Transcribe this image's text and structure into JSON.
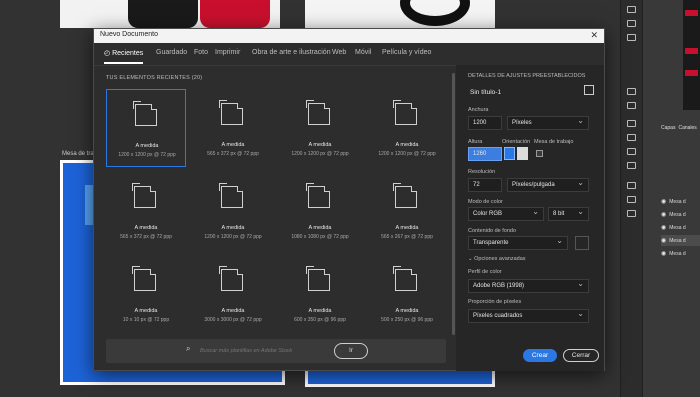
{
  "background": {
    "artboard_label": "Mesa de trab"
  },
  "panel": {
    "tabs": [
      "Capas",
      "Canales"
    ],
    "layer_names": [
      "Mesa d",
      "Mesa d",
      "Mesa d",
      "Mesa d",
      "Mesa d"
    ]
  },
  "dialog": {
    "title": "Nuevo Documento",
    "close": "✕",
    "tabs": [
      "Recientes",
      "Guardado",
      "Foto",
      "Imprimir",
      "Obra de arte e ilustración",
      "Web",
      "Móvil",
      "Película y vídeo"
    ],
    "section_title": "TUS ELEMENTOS RECIENTES",
    "section_count": "(20)",
    "presets": [
      {
        "name": "A medida",
        "dims": "1200 x 1200 px @ 72 ppp"
      },
      {
        "name": "A medida",
        "dims": "565 x 372 px @ 72 ppp"
      },
      {
        "name": "A medida",
        "dims": "1200 x 1200 px @ 72 ppp"
      },
      {
        "name": "A medida",
        "dims": "1200 x 1200 px @ 72 ppp"
      },
      {
        "name": "A medida",
        "dims": "565 x 372 px @ 72 ppp"
      },
      {
        "name": "A medida",
        "dims": "1200 x 1200 px @ 72 ppp"
      },
      {
        "name": "A medida",
        "dims": "1080 x 1080 px @ 72 ppp"
      },
      {
        "name": "A medida",
        "dims": "565 x 267 px @ 72 ppp"
      },
      {
        "name": "A medida",
        "dims": "10 x 10 px @ 72 ppp"
      },
      {
        "name": "A medida",
        "dims": "3000 x 3000 px @ 72 ppp"
      },
      {
        "name": "A medida",
        "dims": "600 x 350 px @ 96 ppp"
      },
      {
        "name": "A medida",
        "dims": "500 x 250 px @ 96 ppp"
      }
    ],
    "search_placeholder": "Buscar más plantillas en Adobe Stock",
    "search_button": "Ir",
    "details": {
      "heading": "DETALLES DE AJUSTES PREESTABLECIDOS",
      "doc_name": "Sin título-1",
      "width_label": "Anchura",
      "width_value": "1200",
      "width_unit": "Píxeles",
      "height_label": "Altura",
      "height_value": "1260",
      "orientation_label": "Orientación",
      "artboard_label": "Mesa de trabajo",
      "resolution_label": "Resolución",
      "resolution_value": "72",
      "resolution_unit": "Píxeles/pulgada",
      "color_mode_label": "Modo de color",
      "color_mode_value": "Color RGB",
      "bit_depth": "8 bit",
      "background_label": "Contenido de fondo",
      "background_value": "Transparente",
      "advanced_label": "Opciones avanzadas",
      "profile_label": "Perfil de color",
      "profile_value": "Adobe RGB (1998)",
      "pixel_ratio_label": "Proporción de píxeles",
      "pixel_ratio_value": "Píxeles cuadrados"
    },
    "create_button": "Crear",
    "close_button": "Cerrar"
  }
}
